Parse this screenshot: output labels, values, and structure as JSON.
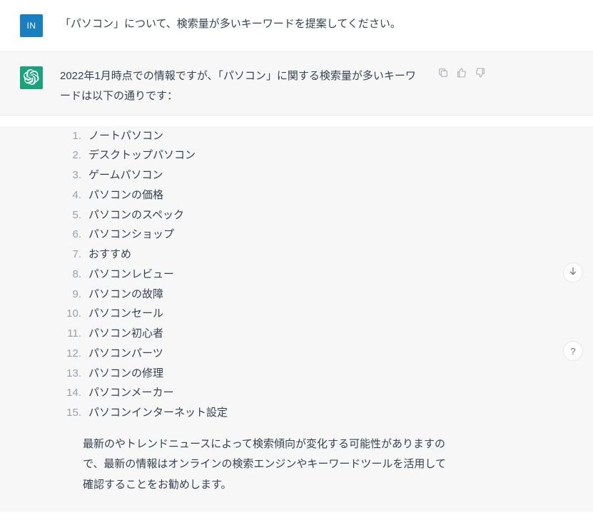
{
  "user": {
    "avatar": "IN",
    "message": "「パソコン」について、検索量が多いキーワードを提案してください。"
  },
  "assistant": {
    "intro": "2022年1月時点での情報ですが、「パソコン」に関する検索量が多いキーワードは以下の通りです：",
    "keywords": [
      "ノートパソコン",
      "デスクトップパソコン",
      "ゲームパソコン",
      "パソコンの価格",
      "パソコンのスペック",
      "パソコンショップ",
      "おすすめ",
      "パソコンレビュー",
      "パソコンの故障",
      "パソコンセール",
      "パソコン初心者",
      "パソコンパーツ",
      "パソコンの修理",
      "パソコンメーカー",
      "パソコンインターネット設定"
    ],
    "outro": "最新のやトレンドニュースによって検索傾向が変化する可能性がありますので、最新の情報はオンラインの検索エンジンやキーワードツールを活用して確認することをお勧めします。"
  },
  "help_label": "?"
}
